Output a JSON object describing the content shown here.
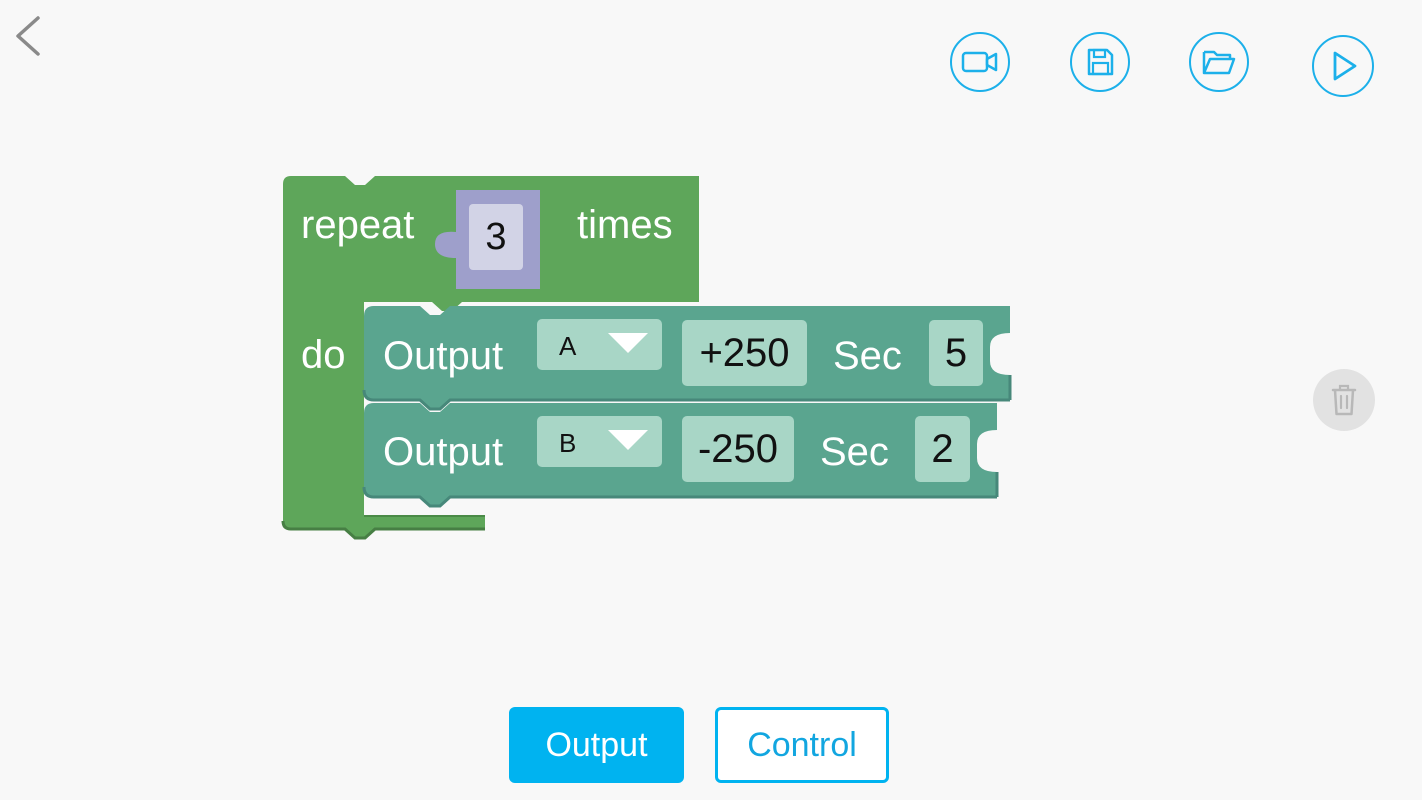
{
  "toolbar": {
    "icons": [
      "video-camera-icon",
      "save-icon",
      "folder-open-icon",
      "play-icon"
    ],
    "accent_color": "#1cb0ea"
  },
  "blocks": {
    "repeat": {
      "label_repeat": "repeat",
      "count": "3",
      "label_times": "times",
      "label_do": "do",
      "color": "#5ea65a"
    },
    "outputs": [
      {
        "label": "Output",
        "port": "A",
        "power": "+250",
        "sec_label": "Sec",
        "seconds": "5"
      },
      {
        "label": "Output",
        "port": "B",
        "power": "-250",
        "sec_label": "Sec",
        "seconds": "2"
      }
    ],
    "output_color": "#5aa58f"
  },
  "tabs": {
    "output": "Output",
    "control": "Control",
    "active": "Output"
  }
}
